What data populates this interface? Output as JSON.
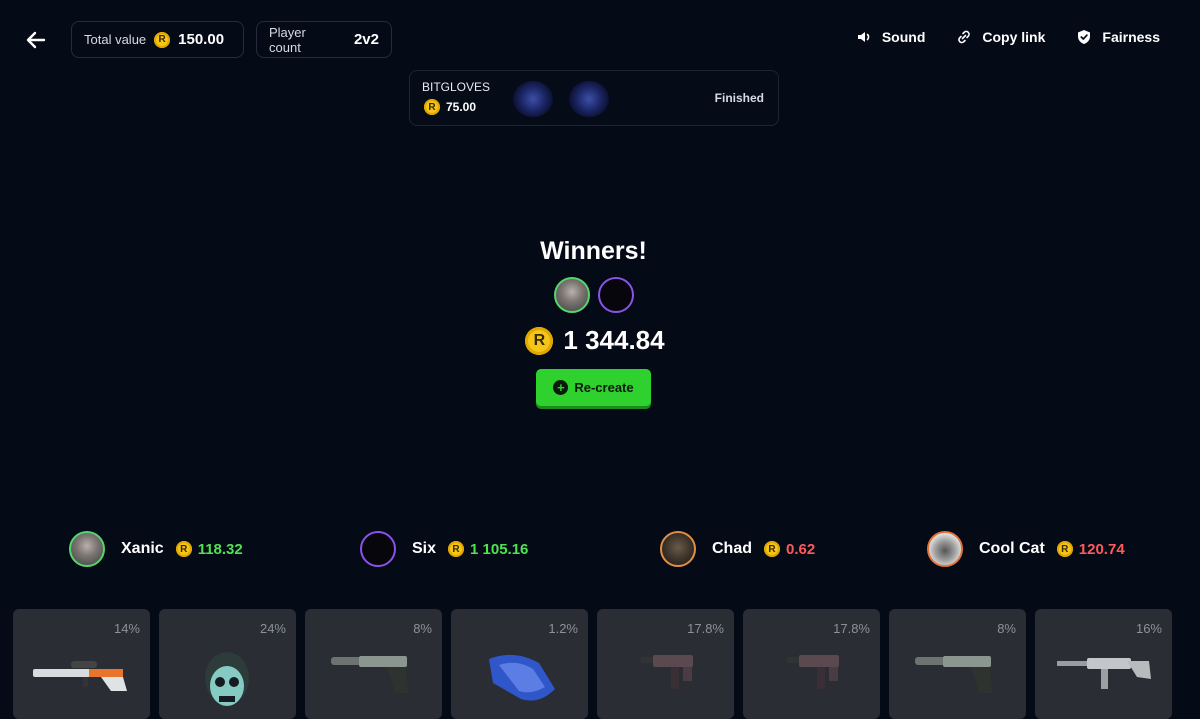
{
  "header": {
    "total_value_label": "Total value",
    "total_value": "150.00",
    "player_count_label": "Player count",
    "player_count": "2v2",
    "nav": [
      {
        "label": "Sound",
        "icon": "speaker-icon"
      },
      {
        "label": "Copy link",
        "icon": "link-icon"
      },
      {
        "label": "Fairness",
        "icon": "shield-check-icon"
      }
    ]
  },
  "case": {
    "name": "BITGLOVES",
    "price": "75.00",
    "status": "Finished"
  },
  "winners": {
    "title": "Winners!",
    "total": "1 344.84",
    "recreate_label": "Re-create"
  },
  "players": [
    {
      "name": "Xanic",
      "amount": "118.32",
      "result": "win"
    },
    {
      "name": "Six",
      "amount": "1 105.16",
      "result": "win"
    },
    {
      "name": "Chad",
      "amount": "0.62",
      "result": "loss"
    },
    {
      "name": "Cool Cat",
      "amount": "120.74",
      "result": "loss"
    }
  ],
  "items": [
    {
      "chance": "14%",
      "icon": "sniper-rifle-icon"
    },
    {
      "chance": "24%",
      "icon": "skull-mask-icon"
    },
    {
      "chance": "8%",
      "icon": "pistol-icon"
    },
    {
      "chance": "1.2%",
      "icon": "gloves-icon"
    },
    {
      "chance": "17.8%",
      "icon": "smg-icon"
    },
    {
      "chance": "17.8%",
      "icon": "smg-icon"
    },
    {
      "chance": "8%",
      "icon": "pistol-icon"
    },
    {
      "chance": "16%",
      "icon": "rifle-icon"
    }
  ],
  "colors": {
    "background": "#050a17",
    "coin": "#f5c518",
    "win_amount": "#4ee44e",
    "loss_amount": "#ff5a5a",
    "recreate_button": "#2fd12f"
  }
}
